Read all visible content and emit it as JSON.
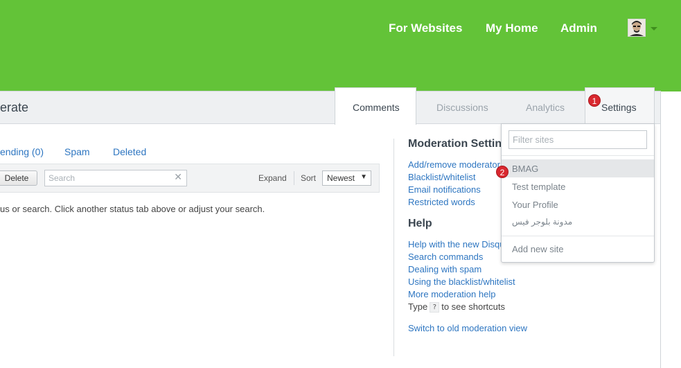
{
  "colors": {
    "header_bg": "#63c338",
    "link": "#2e76c1",
    "badge": "#d9282f"
  },
  "topnav": {
    "items": [
      {
        "label": "For Websites"
      },
      {
        "label": "My Home"
      },
      {
        "label": "Admin"
      }
    ],
    "avatar_icon": "user-avatar",
    "menu_caret_icon": "chevron-down-icon"
  },
  "page": {
    "title": "erate"
  },
  "tabs": [
    {
      "label": "Comments",
      "active": true
    },
    {
      "label": "Discussions"
    },
    {
      "label": "Analytics"
    },
    {
      "label": "Settings"
    }
  ],
  "status_tabs": [
    {
      "label": "ending (0)"
    },
    {
      "label": "Spam"
    },
    {
      "label": "Deleted"
    }
  ],
  "toolbar": {
    "delete_label": "Delete",
    "search_placeholder": "Search",
    "clear_icon": "close-icon",
    "expand_label": "Expand",
    "sort_label": "Sort",
    "sort_value": "Newest"
  },
  "empty_message": "us or search. Click another status tab above or adjust your search.",
  "moderation_settings": {
    "title": "Moderation Settin",
    "links": [
      {
        "label": "Add/remove moderator"
      },
      {
        "label": "Blacklist/whitelist"
      },
      {
        "label": "Email notifications"
      },
      {
        "label": "Restricted words"
      }
    ]
  },
  "help": {
    "title": "Help",
    "links": [
      {
        "label": "Help with the new Disqu"
      },
      {
        "label": "Search commands"
      },
      {
        "label": "Dealing with spam"
      },
      {
        "label": "Using the blacklist/whitelist"
      },
      {
        "label": "More moderation help"
      }
    ],
    "shortcut_prefix": "Type",
    "shortcut_key": "?",
    "shortcut_suffix": "to see shortcuts",
    "old_view_link": "Switch to old moderation view"
  },
  "site_dropdown": {
    "filter_placeholder": "Filter sites",
    "sites": [
      {
        "label": "BMAG",
        "highlighted": true
      },
      {
        "label": "Test template"
      },
      {
        "label": "Your Profile"
      },
      {
        "label": "مدونة بلوجر فيس"
      }
    ],
    "add_label": "Add new site"
  },
  "annotations": [
    {
      "number": "1"
    },
    {
      "number": "2"
    }
  ]
}
